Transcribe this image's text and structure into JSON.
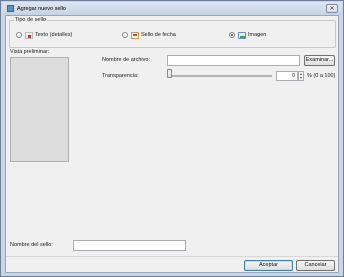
{
  "window": {
    "title": "Agregar nuevo sello",
    "close_glyph": "✕"
  },
  "stamp_type": {
    "legend": "Tipo de sello",
    "options": [
      {
        "label": "Texto (detalles)",
        "icon": "text-stamp-icon",
        "checked": false
      },
      {
        "label": "Sello de fecha",
        "icon": "date-stamp-icon",
        "checked": false
      },
      {
        "label": "Imagen",
        "icon": "image-stamp-icon",
        "checked": true
      }
    ]
  },
  "preview": {
    "label": "Vista preliminar:"
  },
  "file": {
    "label": "Nombre de archivo:",
    "value": "",
    "browse_label": "Examinar..."
  },
  "transparency": {
    "label": "Transparencia:",
    "value": "0",
    "range_hint": "% (0 a 100)"
  },
  "stamp_name": {
    "label": "Nombre del sello:",
    "value": ""
  },
  "buttons": {
    "accept": "Aceptar",
    "cancel": "Cancelar"
  },
  "colors": {
    "frame": "#c9d4e4",
    "client": "#f0f0f0",
    "default_button_border": "#3c7fb1"
  }
}
